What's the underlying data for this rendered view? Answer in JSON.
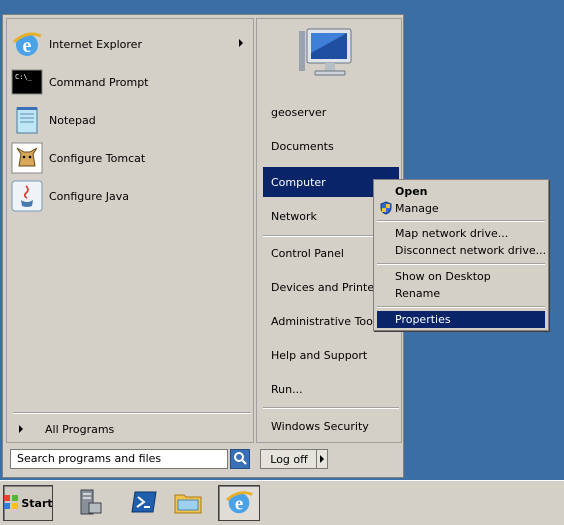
{
  "start_menu": {
    "pinned": [
      {
        "label": "Internet Explorer",
        "icon": "internet-explorer-icon",
        "has_submenu": true
      },
      {
        "label": "Command Prompt",
        "icon": "command-prompt-icon"
      },
      {
        "label": "Notepad",
        "icon": "notepad-icon"
      },
      {
        "label": "Configure Tomcat",
        "icon": "tomcat-icon"
      },
      {
        "label": "Configure Java",
        "icon": "java-icon"
      }
    ],
    "all_programs": "All Programs",
    "search_placeholder": "Search programs and files",
    "log_off": "Log off",
    "right_items": [
      "geoserver",
      "Documents",
      "Computer",
      "Network",
      "Control Panel",
      "Devices and Printers",
      "Administrative Tools",
      "Help and Support",
      "Run...",
      "Windows Security"
    ],
    "selected_right_item": "Computer"
  },
  "context_menu": {
    "items": [
      {
        "label": "Open",
        "bold": true
      },
      {
        "label": "Manage",
        "icon": "shield-icon"
      },
      {
        "label": "Map network drive..."
      },
      {
        "label": "Disconnect network drive..."
      },
      {
        "label": "Show on Desktop"
      },
      {
        "label": "Rename"
      },
      {
        "label": "Properties",
        "selected": true
      }
    ]
  },
  "taskbar": {
    "start_label": "Start",
    "icons": [
      "server-manager-icon",
      "powershell-icon",
      "explorer-folder-icon",
      "internet-explorer-icon"
    ]
  },
  "colors": {
    "desktop": "#3a6ea5",
    "selection": "#0a246a",
    "face": "#d4d0c8"
  }
}
